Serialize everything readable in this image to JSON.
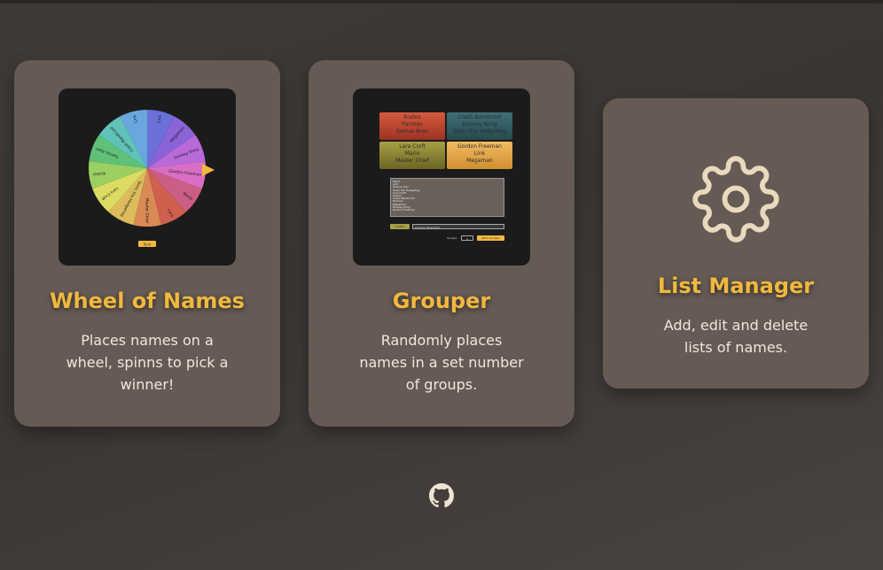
{
  "cards": [
    {
      "title": "Wheel of Names",
      "description": "Places names on a wheel, spinns to pick a winner!",
      "preview": {
        "wheel_names": [
          "Link",
          "Megaman",
          "Donkey Kong",
          "Gordon Freeman",
          "Mario",
          "Lara",
          "Master Chief",
          "Sonic the Hedgehog",
          "Lara Croft",
          "Kratos",
          "Samus Aran",
          "Crash Bandicoot"
        ],
        "wheel_colors": [
          "#6b6fd8",
          "#8a63d8",
          "#b96ad9",
          "#d86fc4",
          "#cc5d86",
          "#cf5f4f",
          "#d98a55",
          "#ddbd5b",
          "#dcdc63",
          "#9ccf62",
          "#5fc077",
          "#60c2b8",
          "#6aa7de"
        ],
        "spin_label": "Spin"
      }
    },
    {
      "title": "Grouper",
      "description": "Randomly places names in a set number of groups.",
      "preview": {
        "groups": [
          [
            "Kratos",
            "Pacman",
            "Samus Aran"
          ],
          [
            "Crash Bandicoot",
            "Donkey Kong",
            "Sonic the Hedgehog"
          ],
          [
            "Lara Croft",
            "Mario",
            "Master Chief"
          ],
          [
            "Gordon Freeman",
            "Link",
            "Megaman"
          ]
        ],
        "names_text": "Mario\nLink\nSamus Aran\nSonic the Hedgehog\nLara Croft\nKratos\nCrash Bandicoot\nPacman\nMegaman\nDonkey Kong\nGordon Freeman",
        "update_label": "Update",
        "list_option": "Gamers (Example)",
        "groups_label": "Groups:",
        "groups_value": "4",
        "start_label": "Start Grouper"
      }
    },
    {
      "title": "List Manager",
      "description": "Add, edit and delete lists of names.",
      "icon": "gear-icon"
    }
  ],
  "footer": {
    "icon": "github-icon"
  },
  "colors": {
    "accent": "#f0b83e",
    "card": "#655a54",
    "text": "#f1e7dc"
  }
}
